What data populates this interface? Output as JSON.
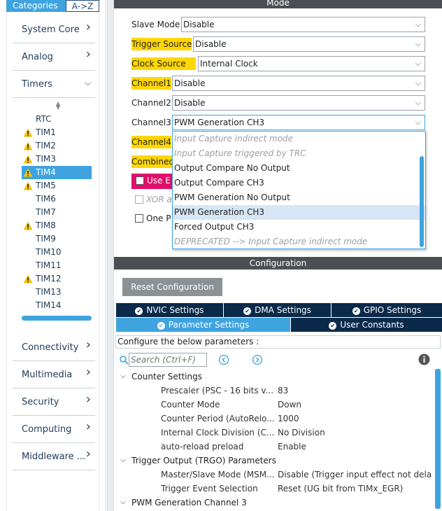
{
  "sidebar": {
    "tabs": {
      "categories": "Categories",
      "az": "A->Z"
    },
    "categories_top": [
      {
        "label": "System Core",
        "chevron": ">"
      },
      {
        "label": "Analog",
        "chevron": ">"
      },
      {
        "label": "Timers",
        "chevron": "v"
      }
    ],
    "timers": [
      {
        "label": "RTC",
        "warning": false
      },
      {
        "label": "TIM1",
        "warning": true
      },
      {
        "label": "TIM2",
        "warning": true
      },
      {
        "label": "TIM3",
        "warning": true
      },
      {
        "label": "TIM4",
        "warning": true,
        "selected": true
      },
      {
        "label": "TIM5",
        "warning": true
      },
      {
        "label": "TIM6",
        "warning": false
      },
      {
        "label": "TIM7",
        "warning": false
      },
      {
        "label": "TIM8",
        "warning": true
      },
      {
        "label": "TIM9",
        "warning": false
      },
      {
        "label": "TIM10",
        "warning": false
      },
      {
        "label": "TIM11",
        "warning": false
      },
      {
        "label": "TIM12",
        "warning": true
      },
      {
        "label": "TIM13",
        "warning": false
      },
      {
        "label": "TIM14",
        "warning": false
      }
    ],
    "categories_bottom": [
      {
        "label": "Connectivity",
        "chevron": ">"
      },
      {
        "label": "Multimedia",
        "chevron": ">"
      },
      {
        "label": "Security",
        "chevron": ">"
      },
      {
        "label": "Computing",
        "chevron": ">"
      },
      {
        "label": "Middleware ...",
        "chevron": ">"
      }
    ]
  },
  "mode": {
    "title": "Mode",
    "rows": [
      {
        "label": "Slave Mode",
        "value": "Disable",
        "highlight": false
      },
      {
        "label": "Trigger Source",
        "value": "Disable",
        "highlight": true
      },
      {
        "label": "Clock Source",
        "value": "Internal Clock",
        "highlight": true
      },
      {
        "label": "Channel1",
        "value": "Disable",
        "highlight": true
      },
      {
        "label": "Channel2",
        "value": "Disable",
        "highlight": false
      },
      {
        "label": "Channel3",
        "value": "PWM Generation CH3",
        "highlight": false
      },
      {
        "label": "Channel4",
        "value": "",
        "highlight": true
      },
      {
        "label": "Combined",
        "value": "",
        "highlight": true
      }
    ],
    "use_etr_label": "Use E",
    "xor_label": "XOR a",
    "one_pulse_label": "One P",
    "dropdown_options": [
      {
        "label": "Input Capture indirect mode",
        "disabled": true
      },
      {
        "label": "Input Capture triggered by TRC",
        "disabled": true
      },
      {
        "label": "Output Compare No Output",
        "disabled": false
      },
      {
        "label": "Output Compare CH3",
        "disabled": false
      },
      {
        "label": "PWM Generation No Output",
        "disabled": false
      },
      {
        "label": "PWM Generation CH3",
        "disabled": false,
        "selected": true
      },
      {
        "label": "Forced Output CH3",
        "disabled": false
      },
      {
        "label": "DEPRECATED --> Input Capture indirect mode",
        "disabled": true
      }
    ]
  },
  "configuration": {
    "title": "Configuration",
    "reset_label": "Reset Configuration",
    "tabs_row1": [
      "NVIC Settings",
      "DMA Settings",
      "GPIO Settings"
    ],
    "tabs_row2": [
      "Parameter Settings",
      "User Constants"
    ],
    "description": "Configure the below parameters :",
    "search_placeholder": "Search (Ctrl+F)",
    "groups": [
      {
        "name": "Counter Settings",
        "params": [
          {
            "name": "Prescaler (PSC - 16 bits v...",
            "value": "83"
          },
          {
            "name": "Counter Mode",
            "value": "Down"
          },
          {
            "name": "Counter Period (AutoRelo...",
            "value": "1000"
          },
          {
            "name": "Internal Clock Division (C...",
            "value": "No Division"
          },
          {
            "name": "auto-reload preload",
            "value": "Enable"
          }
        ]
      },
      {
        "name": "Trigger Output (TRGO) Parameters",
        "params": [
          {
            "name": "Master/Slave Mode (MSM...",
            "value": "Disable (Trigger input effect not dela..."
          },
          {
            "name": "Trigger Event Selection",
            "value": "Reset (UG bit from TIMx_EGR)"
          }
        ]
      },
      {
        "name": "PWM Generation Channel 3",
        "params": []
      }
    ]
  },
  "colors": {
    "accent": "#3ea3df",
    "dark_navy": "#0b2a4a",
    "header_gray": "#4b4f54",
    "highlight_yellow": "#ffd700",
    "warning_yellow": "#f5c400",
    "use_etr_pink": "#e0106a"
  }
}
